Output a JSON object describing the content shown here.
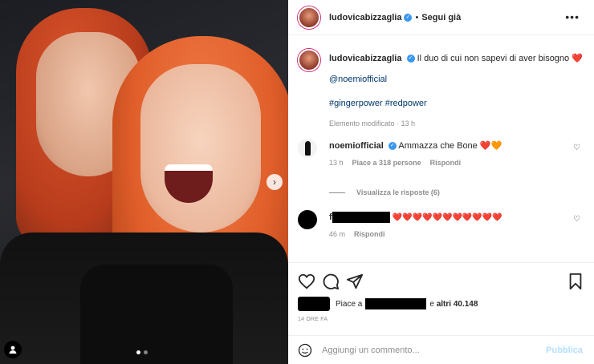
{
  "post": {
    "username": "ludovicabizzaglia",
    "separator": "•",
    "follow_label": "Segui già",
    "more_icon": "more-horizontal-icon"
  },
  "caption": {
    "username": "ludovicabizzaglia",
    "text": "Il duo di cui non sapevi di aver bisogno",
    "emoji": "❤️",
    "mention": "@noemiofficial",
    "hashtags": "#gingerpower #redpower",
    "meta": "Elemento modificato · 13 h"
  },
  "comments": [
    {
      "username": "noemiofficial",
      "text": "Ammazza che Bone",
      "emojis": "❤️🧡",
      "time": "13 h",
      "likes": "Piace a 318 persone",
      "reply": "Rispondi"
    },
    {
      "username_initial": "f",
      "emojis": "❤️❤️❤️❤️❤️❤️❤️❤️❤️❤️❤️",
      "time": "46 m",
      "reply": "Rispondi"
    }
  ],
  "replies_label": "Visualizza le risposte (6)",
  "likes": {
    "prefix": "Piace a",
    "joiner": "e",
    "count": "altri 40.148"
  },
  "timestamp": "14 ORE FA",
  "add_comment": {
    "placeholder": "Aggiungi un commento...",
    "publish_label": "Pubblica"
  },
  "carousel": {
    "current": 1,
    "total": 2
  },
  "colors": {
    "link": "#00376b",
    "verified": "#3897f0",
    "publish_disabled": "#b2dffc",
    "meta": "#8e8e8e"
  }
}
